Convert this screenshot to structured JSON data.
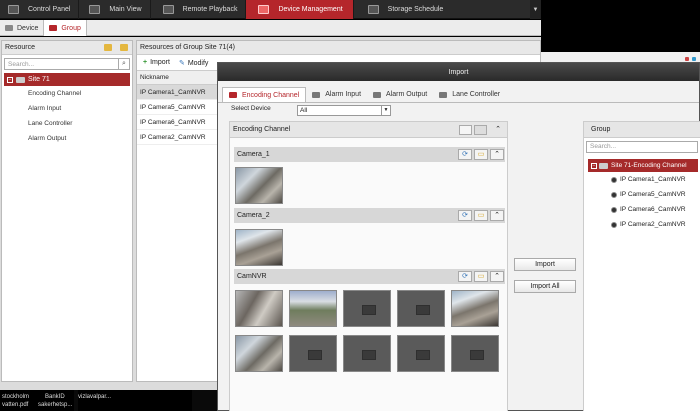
{
  "topnav": {
    "tabs": [
      {
        "label": "Control Panel",
        "icon": "control-panel-icon"
      },
      {
        "label": "Main View",
        "icon": "main-view-icon"
      },
      {
        "label": "Remote Playback",
        "icon": "remote-playback-icon"
      },
      {
        "label": "Device Management",
        "icon": "device-management-icon",
        "active": true
      },
      {
        "label": "Storage Schedule",
        "icon": "storage-schedule-icon"
      }
    ]
  },
  "subtabs": {
    "device": "Device",
    "group": "Group"
  },
  "resource": {
    "title": "Resource",
    "search_placeholder": "Search...",
    "site": "Site 71",
    "items": [
      "Encoding Channel",
      "Alarm Input",
      "Lane Controller",
      "Alarm Output"
    ]
  },
  "group_list": {
    "title": "Resources of Group Site 71(4)",
    "import_label": "Import",
    "modify_label": "Modify",
    "column": "Nickname",
    "rows": [
      "IP Camera1_CamNVR",
      "IP Camera5_CamNVR",
      "IP Camera6_CamNVR",
      "IP Camera2_CamNVR"
    ]
  },
  "taskbar": {
    "labels": [
      "stockholm",
      "vatten.pdf",
      "BankID",
      "sakerhetsp...",
      "vizlavalpar..."
    ]
  },
  "dialog": {
    "title": "Import",
    "tabs": [
      "Encoding Channel",
      "Alarm Input",
      "Alarm Output",
      "Lane Controller"
    ],
    "select_device_label": "Select Device",
    "select_device_value": "All",
    "encoding_title": "Encoding Channel",
    "devices": [
      "Camera_1",
      "Camera_2",
      "CamNVR"
    ],
    "import_btn": "Import",
    "import_all_btn": "Import All",
    "group_title": "Group",
    "group_search": "Search...",
    "group_site": "Site 71-Encoding Channel",
    "group_items": [
      "IP Camera1_CamNVR",
      "IP Camera5_CamNVR",
      "IP Camera6_CamNVR",
      "IP Camera2_CamNVR"
    ]
  },
  "colors": {
    "accent": "#b5262b",
    "site_bg": "#a52a2a"
  }
}
